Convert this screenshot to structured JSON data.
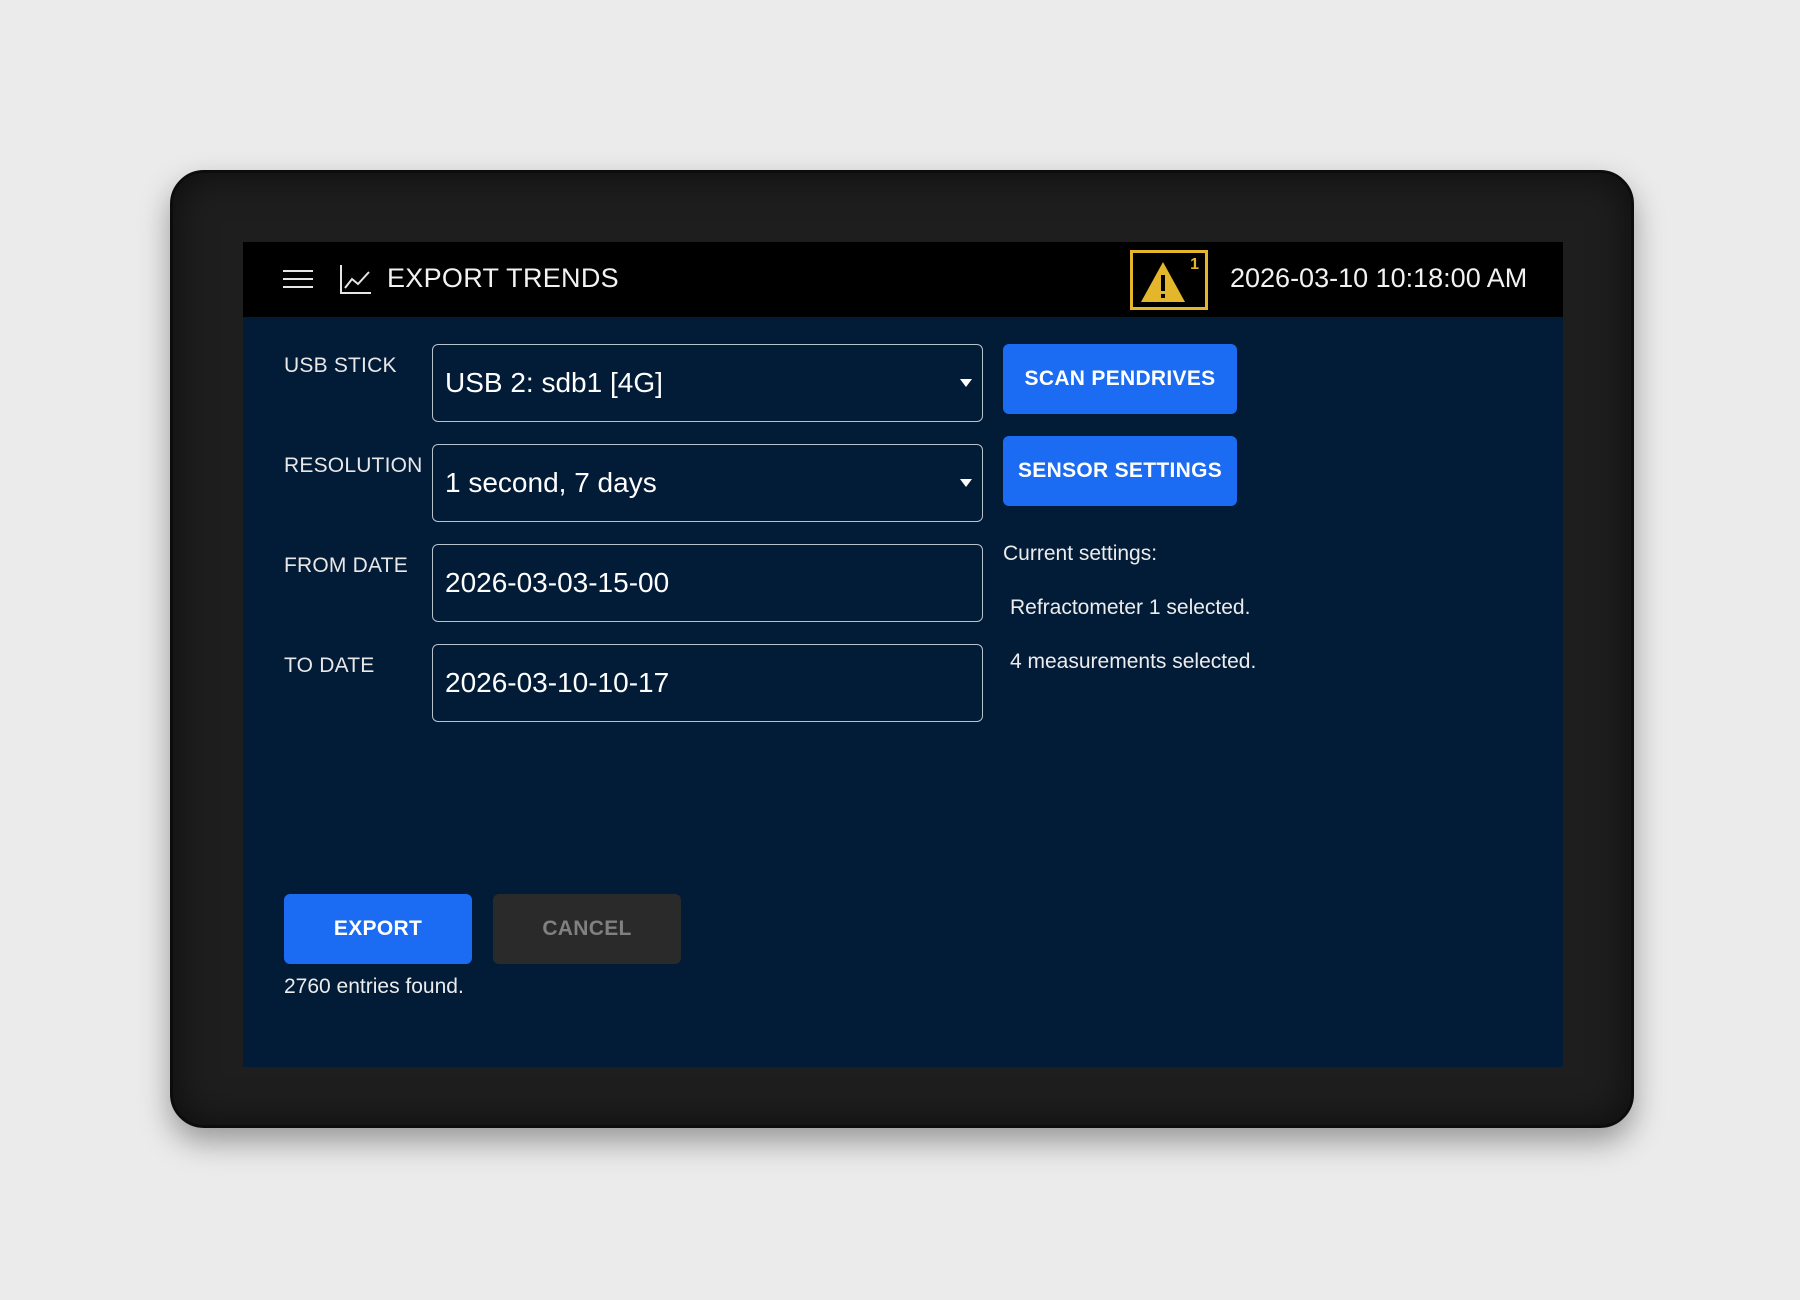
{
  "header": {
    "title": "EXPORT TRENDS",
    "alarm_count": "1",
    "datetime": "2026-03-10 10:18:00 AM",
    "icons": {
      "menu": "hamburger-menu-icon",
      "title": "line-chart-icon",
      "alarm": "warning-triangle-icon"
    }
  },
  "form": {
    "usb_label": "USB STICK",
    "usb_value": "USB 2: sdb1 [4G]",
    "resolution_label": "RESOLUTION",
    "resolution_value": "1 second, 7 days",
    "from_label": "FROM DATE",
    "from_value": "2026-03-03-15-00",
    "to_label": "TO DATE",
    "to_value": "2026-03-10-10-17"
  },
  "side": {
    "scan_label": "SCAN PENDRIVES",
    "sensor_label": "SENSOR SETTINGS",
    "current_heading": "Current settings:",
    "sensor_line": "Refractometer 1 selected.",
    "measure_line": "4 measurements selected."
  },
  "actions": {
    "export_label": "EXPORT",
    "cancel_label": "CANCEL",
    "entries_text": "2760 entries found."
  },
  "colors": {
    "screen_bg": "#021b36",
    "topbar_bg": "#000000",
    "accent_blue": "#1b6cf2",
    "alarm_yellow": "#e3b62b"
  }
}
